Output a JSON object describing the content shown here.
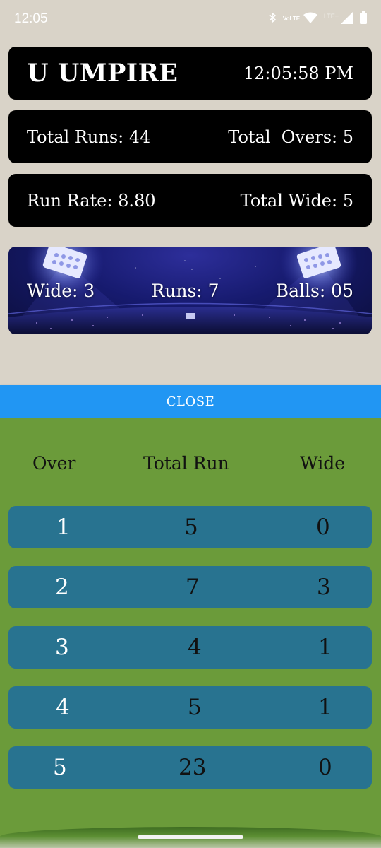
{
  "status_bar": {
    "time": "12:05",
    "volte": "VoLTE",
    "network": "LTE+"
  },
  "header": {
    "app_title": "U UMPIRE",
    "clock": "12:05:58 PM"
  },
  "summary": {
    "total_runs_label": "Total Runs: 44",
    "total_overs_label": "Total  Overs: 5",
    "run_rate_label": "Run Rate: 8.80",
    "total_wide_label": "Total Wide: 5"
  },
  "current_over": {
    "wide_label": "Wide: 3",
    "runs_label": "Runs: 7",
    "balls_label": "Balls: 05"
  },
  "close_button": "CLOSE",
  "table": {
    "headers": [
      "Over",
      "Total Run",
      "Wide"
    ],
    "rows": [
      {
        "over": "1",
        "total_run": "5",
        "wide": "0"
      },
      {
        "over": "2",
        "total_run": "7",
        "wide": "3"
      },
      {
        "over": "3",
        "total_run": "4",
        "wide": "1"
      },
      {
        "over": "4",
        "total_run": "5",
        "wide": "1"
      },
      {
        "over": "5",
        "total_run": "23",
        "wide": "0"
      }
    ]
  },
  "colors": {
    "background": "#d9d3c8",
    "card": "#000000",
    "close_button": "#2196f3",
    "sheet": "#6b9b3a",
    "row": "#287390"
  }
}
